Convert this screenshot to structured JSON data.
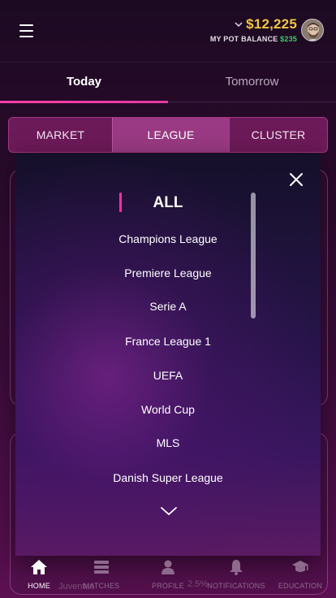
{
  "header": {
    "balance": "$12,225",
    "pot_label": "MY POT BALANCE",
    "pot_value": "$235"
  },
  "day_tabs": [
    {
      "label": "Today",
      "active": true
    },
    {
      "label": "Tomorrow",
      "active": false
    }
  ],
  "filter_tabs": [
    {
      "label": "MARKET",
      "active": false
    },
    {
      "label": "LEAGUE",
      "active": true
    },
    {
      "label": "CLUSTER",
      "active": false
    }
  ],
  "dropdown": {
    "items": [
      "ALL",
      "Champions League",
      "Premiere League",
      "Serie A",
      "France League 1",
      "UEFA",
      "World Cup",
      "MLS",
      "Danish Super League"
    ],
    "selected": "ALL"
  },
  "bottom_nav": [
    {
      "label": "HOME",
      "icon": "home-icon",
      "active": true
    },
    {
      "label": "MATCHES",
      "icon": "matches-icon",
      "active": false
    },
    {
      "label": "PROFILE",
      "icon": "profile-icon",
      "active": false
    },
    {
      "label": "NOTIFICATIONS",
      "icon": "bell-icon",
      "active": false
    },
    {
      "label": "EDUCATION",
      "icon": "graduation-cap-icon",
      "active": false
    }
  ],
  "background_peek": {
    "text_left": "Juventus",
    "text_pct": "2.5%"
  },
  "colors": {
    "accent": "#ff2fa0",
    "balance": "#f2c53d",
    "pot_green": "#35d05a"
  }
}
